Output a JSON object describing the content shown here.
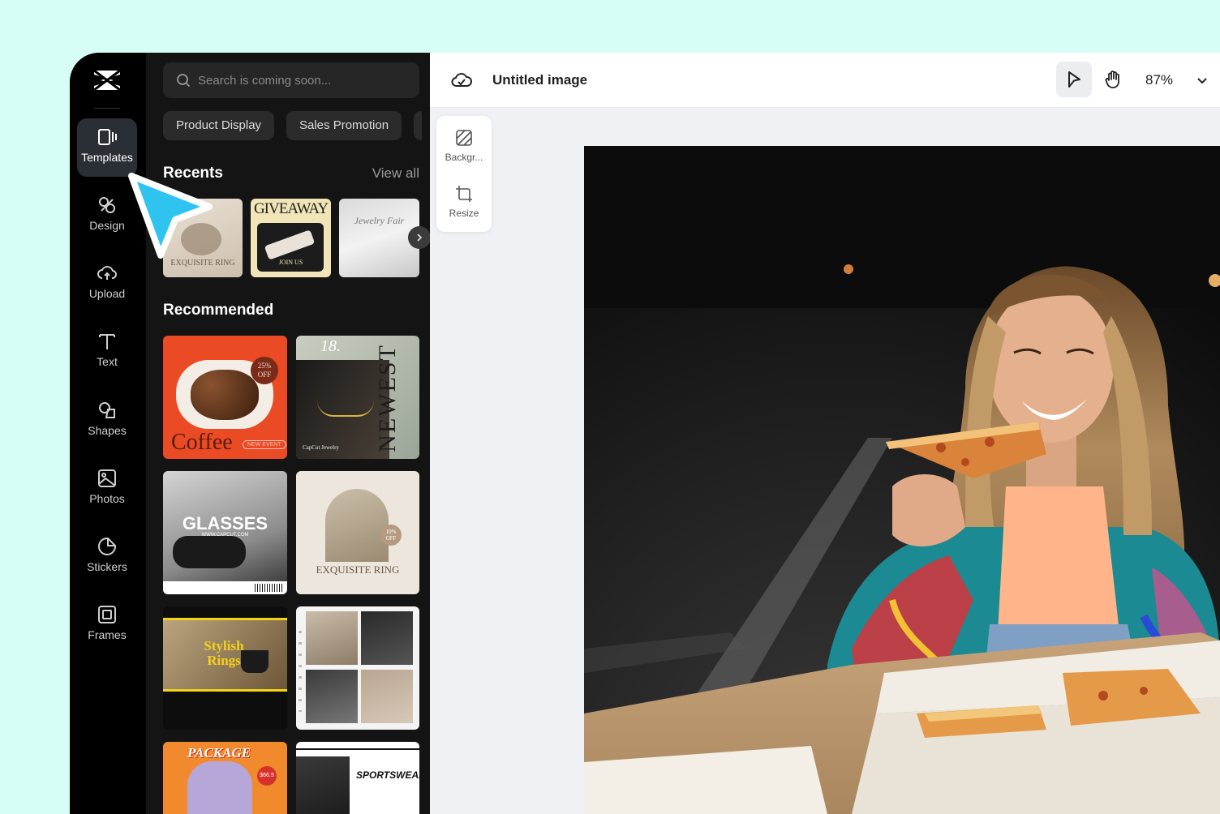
{
  "sidebar": {
    "items": [
      {
        "label": "Templates",
        "icon": "templates-icon"
      },
      {
        "label": "Design",
        "icon": "design-icon"
      },
      {
        "label": "Upload",
        "icon": "upload-icon"
      },
      {
        "label": "Text",
        "icon": "text-icon"
      },
      {
        "label": "Shapes",
        "icon": "shapes-icon"
      },
      {
        "label": "Photos",
        "icon": "photos-icon"
      },
      {
        "label": "Stickers",
        "icon": "stickers-icon"
      },
      {
        "label": "Frames",
        "icon": "frames-icon"
      }
    ],
    "active": "Templates"
  },
  "panel": {
    "search_placeholder": "Search is coming soon...",
    "chips": [
      "Product Display",
      "Sales Promotion"
    ],
    "recents_title": "Recents",
    "view_all": "View all",
    "recommended_title": "Recommended",
    "recents": [
      {
        "text": "EXQUISITE RING"
      },
      {
        "text": "GIVEAWAY",
        "sub": "JOIN US"
      },
      {
        "text": "Jewelry Fair"
      }
    ],
    "recommended": [
      {
        "text": "Coffee",
        "badge": "25% OFF",
        "tag": "NEW EVENT"
      },
      {
        "text": "NEWEST",
        "number": "18.",
        "caption": "CapCut Jewelry"
      },
      {
        "text": "GLASSES",
        "caption": "WWW.CAPCUT.COM"
      },
      {
        "text": "EXQUISITE RING",
        "badge": "10% OFF"
      },
      {
        "text": "Stylish Rings"
      },
      {
        "text": ""
      },
      {
        "text": "PACKAGE",
        "badge": "$66.9"
      },
      {
        "text": "SPORTSWEAR"
      }
    ]
  },
  "topbar": {
    "title": "Untitled image",
    "zoom": "87%"
  },
  "tools": {
    "background_label": "Backgr...",
    "resize_label": "Resize"
  },
  "colors": {
    "accent_cursor": "#2fc4f0",
    "page_bg": "#d6fdf6"
  }
}
